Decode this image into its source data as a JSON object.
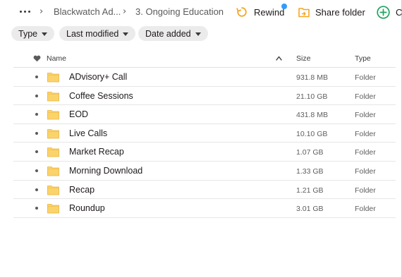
{
  "breadcrumb": {
    "items": [
      "Blackwatch Ad...",
      "3. Ongoing Education"
    ]
  },
  "toolbar": {
    "rewind_label": "Rewind",
    "share_label": "Share folder",
    "create_label": "C"
  },
  "filters": [
    {
      "label": "Type"
    },
    {
      "label": "Last modified"
    },
    {
      "label": "Date added"
    }
  ],
  "table": {
    "columns": {
      "name": "Name",
      "size": "Size",
      "type": "Type"
    },
    "rows": [
      {
        "name": "ADvisory+ Call",
        "size": "931.8 MB",
        "type": "Folder"
      },
      {
        "name": "Coffee Sessions",
        "size": "21.10 GB",
        "type": "Folder"
      },
      {
        "name": "EOD",
        "size": "431.8 MB",
        "type": "Folder"
      },
      {
        "name": "Live Calls",
        "size": "10.10 GB",
        "type": "Folder"
      },
      {
        "name": "Market Recap",
        "size": "1.07 GB",
        "type": "Folder"
      },
      {
        "name": "Morning Download",
        "size": "1.33 GB",
        "type": "Folder"
      },
      {
        "name": "Recap",
        "size": "1.21 GB",
        "type": "Folder"
      },
      {
        "name": "Roundup",
        "size": "3.01 GB",
        "type": "Folder"
      }
    ]
  },
  "colors": {
    "rewind_accent": "#f5a623",
    "share_accent": "#f5a623",
    "create_accent": "#1ea362",
    "folder_fill": "#fbd36b",
    "notification_dot": "#2f9bff"
  }
}
